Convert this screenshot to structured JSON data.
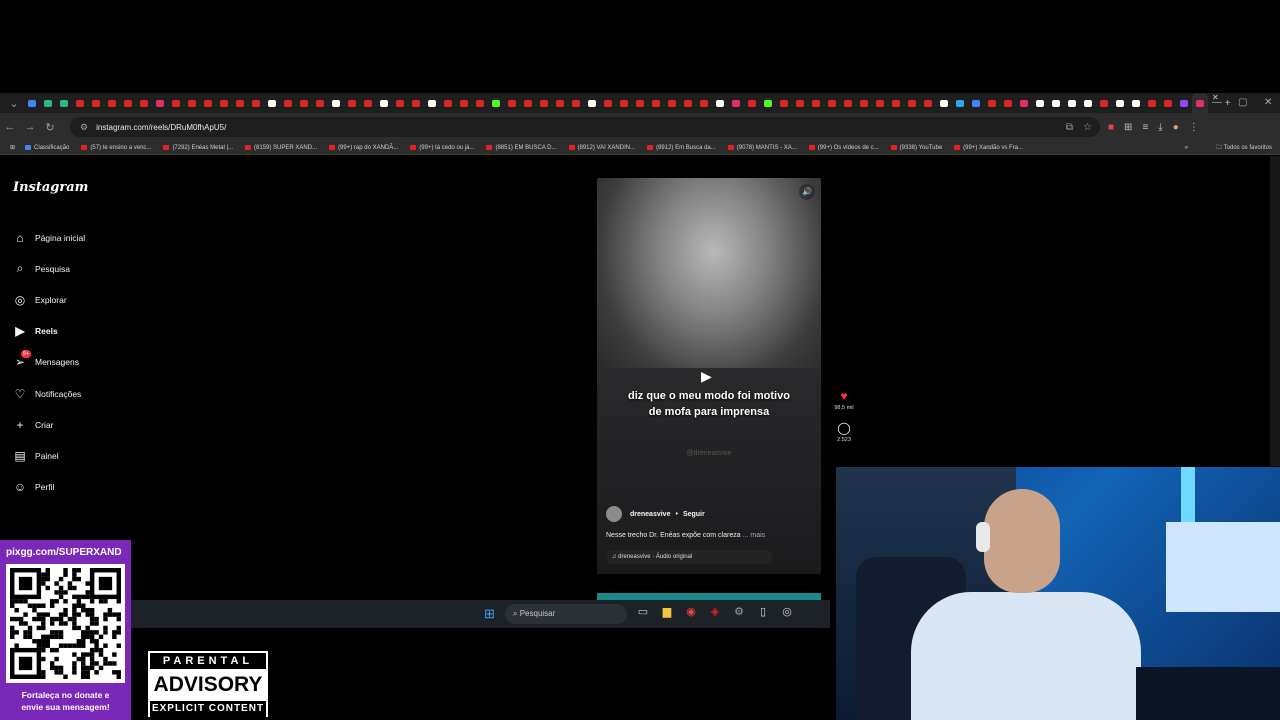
{
  "browser": {
    "url": "instagram.com/reels/DRuM0fhApU5/",
    "tab_colors": [
      "#4285f4",
      "#2eb886",
      "#2eb886",
      "#e02424",
      "#e02424",
      "#e02424",
      "#e02424",
      "#e02424",
      "#e1306c",
      "#e02424",
      "#e02424",
      "#e02424",
      "#e02424",
      "#e02424",
      "#e02424",
      "#ffffff",
      "#e02424",
      "#e02424",
      "#e02424",
      "#ffffff",
      "#e02424",
      "#e02424",
      "#ffffff",
      "#e02424",
      "#e02424",
      "#ffffff",
      "#e02424",
      "#e02424",
      "#e02424",
      "#53fc18",
      "#e02424",
      "#e02424",
      "#e02424",
      "#e02424",
      "#e02424",
      "#ffffff",
      "#e02424",
      "#e02424",
      "#e02424",
      "#e02424",
      "#e02424",
      "#e02424",
      "#e02424",
      "#ffffff",
      "#e1306c",
      "#e02424",
      "#53fc18",
      "#e02424",
      "#e02424",
      "#e02424",
      "#e02424",
      "#e02424",
      "#e02424",
      "#e02424",
      "#e02424",
      "#e02424",
      "#e02424",
      "#ffffff",
      "#2aabee",
      "#4285f4",
      "#e02424",
      "#e02424",
      "#e1306c",
      "#ffffff",
      "#ffffff",
      "#ffffff",
      "#ffffff",
      "#e02424",
      "#ffffff",
      "#ffffff",
      "#e02424",
      "#e02424",
      "#9146ff",
      "#e1306c"
    ],
    "bookmarks": [
      "Classificação",
      "(57) te ensino a venc...",
      "(7292) Enéas Metal |...",
      "(8159) SUPER XAND...",
      "(99+) rap do XANDÃ...",
      "(99+) tá cedo ou já...",
      "(8851) EM BUSCA D...",
      "(8912) VAI XANDIN...",
      "(8912) Em Busca da...",
      "(9078) MANTIS - XA...",
      "(99+) Os vídeos de c...",
      "(9338) YouTube",
      "(99+) Xandão vs Fra..."
    ],
    "bookmarks_more": "»",
    "all_bookmarks": "Todos os favoritos"
  },
  "instagram": {
    "logo": "Instagram",
    "nav": [
      {
        "label": "Página inicial",
        "icon": "home-icon"
      },
      {
        "label": "Pesquisa",
        "icon": "search-icon"
      },
      {
        "label": "Explorar",
        "icon": "compass-icon"
      },
      {
        "label": "Reels",
        "icon": "reels-icon"
      },
      {
        "label": "Mensagens",
        "icon": "messages-icon",
        "badge": "9+"
      },
      {
        "label": "Notificações",
        "icon": "heart-icon"
      },
      {
        "label": "Criar",
        "icon": "plus-icon"
      },
      {
        "label": "Painel",
        "icon": "dashboard-icon"
      },
      {
        "label": "Perfil",
        "icon": "profile-icon"
      }
    ],
    "reel": {
      "caption_line1": "diz que o meu modo foi motivo",
      "caption_line2": "de mofa para imprensa",
      "watermark": "@dreneasvive",
      "username": "dreneasvive",
      "follow": "Seguir",
      "description": "Nesse trecho Dr. Enéas expõe com clareza",
      "more": "... mais",
      "audio": "dreneasvive · Áudio original"
    },
    "actions": {
      "likes": "98,5 mil",
      "comments": "2.523"
    }
  },
  "taskbar": {
    "search_placeholder": "Pesquisar"
  },
  "overlay": {
    "donate_url": "pixgg.com/SUPERXAND",
    "donate_line1": "Fortaleça no donate e",
    "donate_line2": "envie sua mensagem!",
    "advisory_top": "PARENTAL",
    "advisory_mid": "ADVISORY",
    "advisory_bottom": "EXPLICIT CONTENT"
  }
}
